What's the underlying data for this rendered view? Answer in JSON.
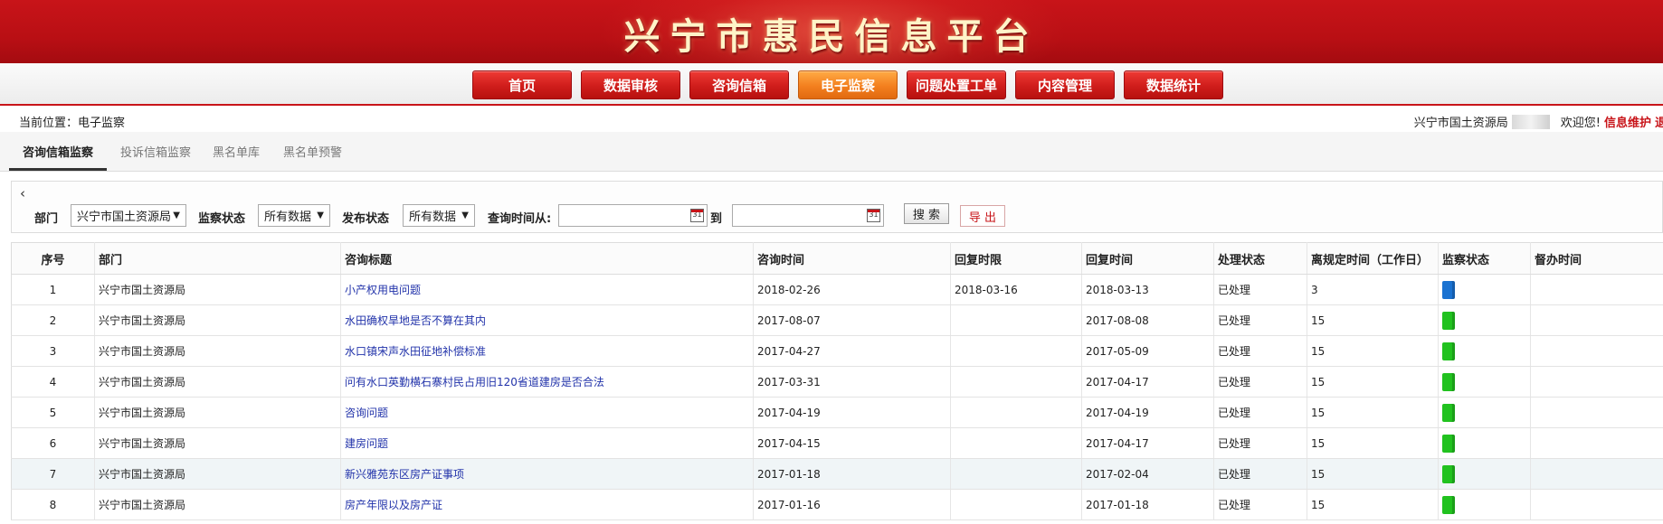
{
  "header": {
    "title": "兴宁市惠民信息平台"
  },
  "nav": {
    "items": [
      {
        "label": "首页",
        "active": false
      },
      {
        "label": "数据审核",
        "active": false
      },
      {
        "label": "咨询信箱",
        "active": false
      },
      {
        "label": "电子监察",
        "active": true
      },
      {
        "label": "问题处置工单",
        "active": false
      },
      {
        "label": "内容管理",
        "active": false
      },
      {
        "label": "数据统计",
        "active": false
      }
    ]
  },
  "location": {
    "current": "当前位置：电子监察",
    "org": "兴宁市国土资源局",
    "welcome": "欢迎您!",
    "link": "信息维护",
    "link_tail": "退"
  },
  "tabs": [
    {
      "label": "咨询信箱监察",
      "active": true
    },
    {
      "label": "投诉信箱监察",
      "active": false
    },
    {
      "label": "黑名单库",
      "active": false
    },
    {
      "label": "黑名单预警",
      "active": false
    }
  ],
  "filter": {
    "back_symbol": "‹",
    "department_label": "部门",
    "department_value": "兴宁市国土资源局",
    "monitor_label": "监察状态",
    "monitor_value": "所有数据",
    "publish_label": "发布状态",
    "publish_value": "所有数据",
    "time_from_label": "查询时间从:",
    "time_to_label": "到",
    "calendar_label": "31",
    "search_button": "搜 索",
    "export_button": "导 出"
  },
  "table": {
    "columns": [
      "序号",
      "部门",
      "咨询标题",
      "咨询时间",
      "回复时限",
      "回复时间",
      "处理状态",
      "离规定时间（工作日）",
      "监察状态",
      "督办时间"
    ],
    "status_colors": {
      "blue": "#1a72d1",
      "green": "#21c21f"
    },
    "rows": [
      {
        "no": "1",
        "dept": "兴宁市国土资源局",
        "title": "小产权用电问题",
        "ask_time": "2018-02-26",
        "deadline": "2018-03-16",
        "reply_time": "2018-03-13",
        "status": "已处理",
        "remaining": "3",
        "monitor": "blue",
        "supervise": ""
      },
      {
        "no": "2",
        "dept": "兴宁市国土资源局",
        "title": "水田确权旱地是否不算在其内",
        "ask_time": "2017-08-07",
        "deadline": "",
        "reply_time": "2017-08-08",
        "status": "已处理",
        "remaining": "15",
        "monitor": "green",
        "supervise": ""
      },
      {
        "no": "3",
        "dept": "兴宁市国土资源局",
        "title": "水口镇宋声水田征地补偿标准",
        "ask_time": "2017-04-27",
        "deadline": "",
        "reply_time": "2017-05-09",
        "status": "已处理",
        "remaining": "15",
        "monitor": "green",
        "supervise": ""
      },
      {
        "no": "4",
        "dept": "兴宁市国土资源局",
        "title": "问有水口英勤横石寨村民占用旧120省道建房是否合法",
        "ask_time": "2017-03-31",
        "deadline": "",
        "reply_time": "2017-04-17",
        "status": "已处理",
        "remaining": "15",
        "monitor": "green",
        "supervise": ""
      },
      {
        "no": "5",
        "dept": "兴宁市国土资源局",
        "title": "咨询问题",
        "ask_time": "2017-04-19",
        "deadline": "",
        "reply_time": "2017-04-19",
        "status": "已处理",
        "remaining": "15",
        "monitor": "green",
        "supervise": ""
      },
      {
        "no": "6",
        "dept": "兴宁市国土资源局",
        "title": "建房问题",
        "ask_time": "2017-04-15",
        "deadline": "",
        "reply_time": "2017-04-17",
        "status": "已处理",
        "remaining": "15",
        "monitor": "green",
        "supervise": ""
      },
      {
        "no": "7",
        "dept": "兴宁市国土资源局",
        "title": "新兴雅苑东区房产证事项",
        "ask_time": "2017-01-18",
        "deadline": "",
        "reply_time": "2017-02-04",
        "status": "已处理",
        "remaining": "15",
        "monitor": "green",
        "supervise": "",
        "highlight": true
      },
      {
        "no": "8",
        "dept": "兴宁市国土资源局",
        "title": "房产年限以及房产证",
        "ask_time": "2017-01-16",
        "deadline": "",
        "reply_time": "2017-01-18",
        "status": "已处理",
        "remaining": "15",
        "monitor": "green",
        "supervise": ""
      }
    ]
  }
}
